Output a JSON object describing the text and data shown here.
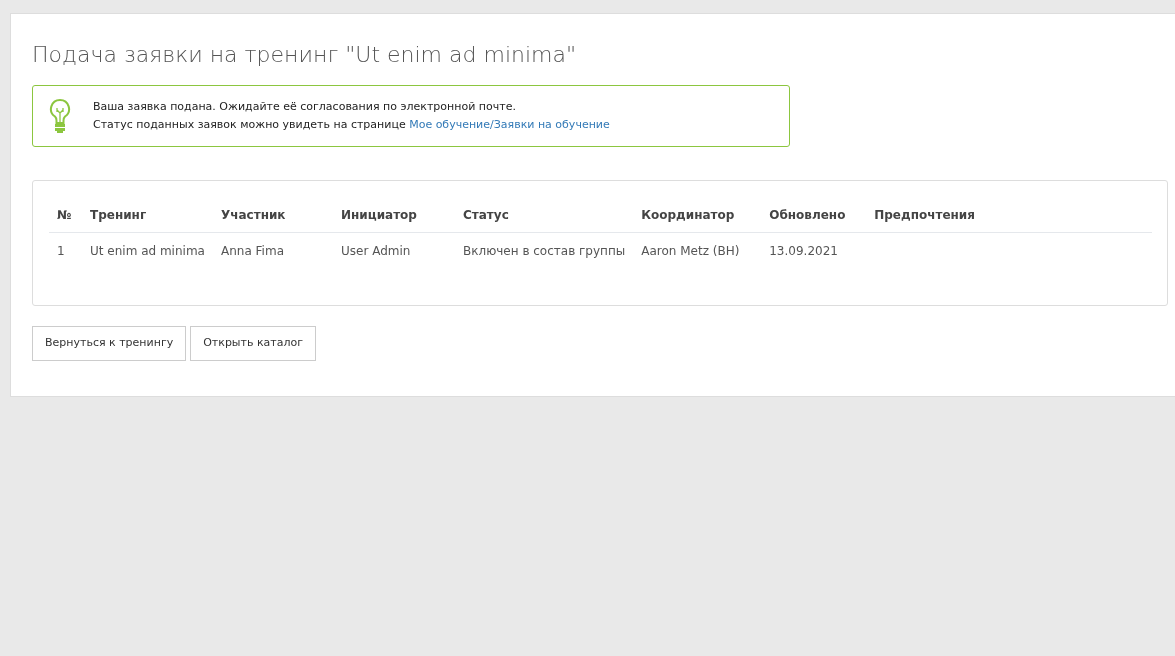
{
  "title": "Подача заявки на тренинг \"Ut enim ad minima\"",
  "alert": {
    "line_1": "Ваша заявка подана. Ожидайте её согласования по электронной почте.",
    "line_2": "Статус поданных заявок можно увидеть на странице",
    "link": "Мое обучение/Заявки на обучение"
  },
  "table": {
    "columns": [
      "№",
      "Тренинг",
      "Участник",
      "Инициатор",
      "Статус",
      "Координатор",
      "Обновлено",
      "Предпочтения"
    ],
    "rows": [
      [
        "1",
        "Ut enim ad minima",
        "Anna Fima",
        "User Admin",
        "Включен в состав группы",
        "Aaron Metz (BH)",
        "13.09.2021"
      ]
    ]
  },
  "buttons": [
    "Вернуться к тренингу",
    "Открыть каталог"
  ]
}
